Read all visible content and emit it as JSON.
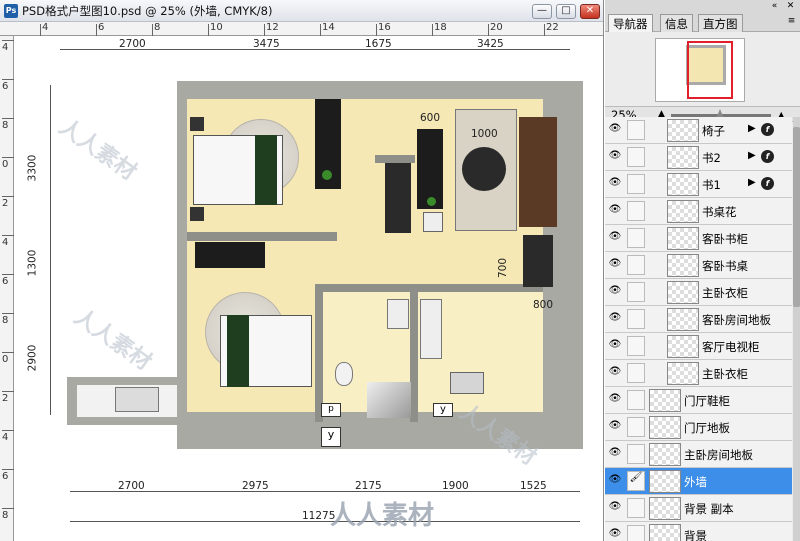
{
  "window": {
    "title": "PSD格式户型图10.psd @ 25% (外墙, CMYK/8)",
    "min_symbol": "—",
    "max_symbol": "□",
    "close_symbol": "✕"
  },
  "ruler": {
    "h_labels": [
      "4",
      "6",
      "8",
      "10",
      "12",
      "14",
      "16",
      "18",
      "20",
      "22"
    ],
    "v_labels": [
      "4",
      "6",
      "8",
      "0",
      "2",
      "4",
      "6",
      "8",
      "0",
      "2",
      "4",
      "6",
      "8"
    ]
  },
  "floorplan": {
    "top_dims": [
      "2700",
      "3475",
      "1675",
      "3425"
    ],
    "left_dims": [
      "3300",
      "1300",
      "2900"
    ],
    "bottom_dims": [
      "2700",
      "2975",
      "2175",
      "1900",
      "1525"
    ],
    "total_width": "11275",
    "inner_dims": {
      "d600": "600",
      "d1000": "1000",
      "d700": "700",
      "d800": "800"
    },
    "labels": {
      "p": "p",
      "y1": "y",
      "y2": "y"
    },
    "watermark": "人人素材"
  },
  "panel": {
    "tabs": [
      "导航器",
      "信息",
      "直方图"
    ],
    "collapse": "«",
    "close": "✕",
    "menu": "≡",
    "zoom": "25%",
    "zoom_minus": "▲",
    "zoom_plus": "▲"
  },
  "layers": [
    {
      "name": "椅子",
      "fx": true,
      "group": true
    },
    {
      "name": "书2",
      "fx": true,
      "group": true
    },
    {
      "name": "书1",
      "fx": true,
      "group": true
    },
    {
      "name": "书桌花",
      "fx": false,
      "group": true
    },
    {
      "name": "客卧书柜",
      "fx": false,
      "group": true
    },
    {
      "name": "客卧书桌",
      "fx": false,
      "group": true
    },
    {
      "name": "主卧衣柜",
      "fx": false,
      "group": true
    },
    {
      "name": "客卧房间地板",
      "fx": false,
      "group": true
    },
    {
      "name": "客厅电视柜",
      "fx": false,
      "group": true
    },
    {
      "name": "主卧衣柜",
      "fx": false,
      "group": true
    },
    {
      "name": "门厅鞋柜",
      "fx": false,
      "group": false
    },
    {
      "name": "门厅地板",
      "fx": false,
      "group": false
    },
    {
      "name": "主卧房间地板",
      "fx": false,
      "group": false
    },
    {
      "name": "外墙",
      "fx": false,
      "group": false,
      "selected": true
    },
    {
      "name": "背景 副本",
      "fx": false,
      "group": false
    },
    {
      "name": "背景",
      "fx": false,
      "group": false
    }
  ],
  "colors": {
    "selection": "#3c8ee8",
    "navigator_box": "#e0202a"
  }
}
